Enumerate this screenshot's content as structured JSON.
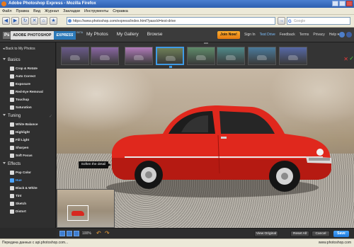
{
  "browser": {
    "title": "Adobe Photoshop Express - Mozilla Firefox",
    "menu": [
      "Файл",
      "Правка",
      "Вид",
      "Журнал",
      "Закладки",
      "Инструменты",
      "Справка"
    ],
    "url": "https://www.photoshop.com/express/index.html?passId=test-drive",
    "search_placeholder": "Google",
    "status_text": "Передача данных с api.photoshop.com...",
    "status_right": "www.photoshop.com"
  },
  "app": {
    "logo": {
      "adobe": "ADOBE",
      "photoshop": "PHOTOSHOP",
      "express": "EXPRESS",
      "beta": "BETA"
    },
    "nav": [
      "My Photos",
      "My Gallery",
      "Browse"
    ],
    "join_label": "Join Now!",
    "right_nav": [
      "Sign In",
      "Test Drive",
      "Feedback",
      "Terms",
      "Privacy",
      "Help"
    ],
    "active_right_nav": "Test Drive",
    "help_dropdown": "▾"
  },
  "sidebar": {
    "back": "Back to My Photos",
    "sections": [
      {
        "title": "Basics",
        "tools": [
          "Crop & Rotate",
          "Auto Correct",
          "Exposure",
          "Red-Eye Removal",
          "Touchup",
          "Saturation"
        ]
      },
      {
        "title": "Tuning",
        "tools": [
          "White Balance",
          "Highlight",
          "Fill Light",
          "Sharpen",
          "Soft Focus"
        ]
      },
      {
        "title": "Effects",
        "tools": [
          "Pop Color",
          "Hue",
          "Black & White",
          "Tint",
          "Sketch",
          "Distort"
        ]
      }
    ],
    "active_tool": "Hue"
  },
  "filmstrip": {
    "thumb_colors": [
      "#6a5a8a",
      "#8a66a3",
      "#b07ab9",
      "#6e7f57",
      "#5f8b6a",
      "#4f8a8a",
      "#4a7a9c",
      "#5668a6"
    ],
    "selected_index": 3
  },
  "photo": {
    "tooltip": "Soften the detail"
  },
  "bottombar": {
    "zoom": "100%",
    "view_original": "View Original",
    "reset_all": "Reset All",
    "cancel": "Cancel",
    "save": "Save"
  }
}
